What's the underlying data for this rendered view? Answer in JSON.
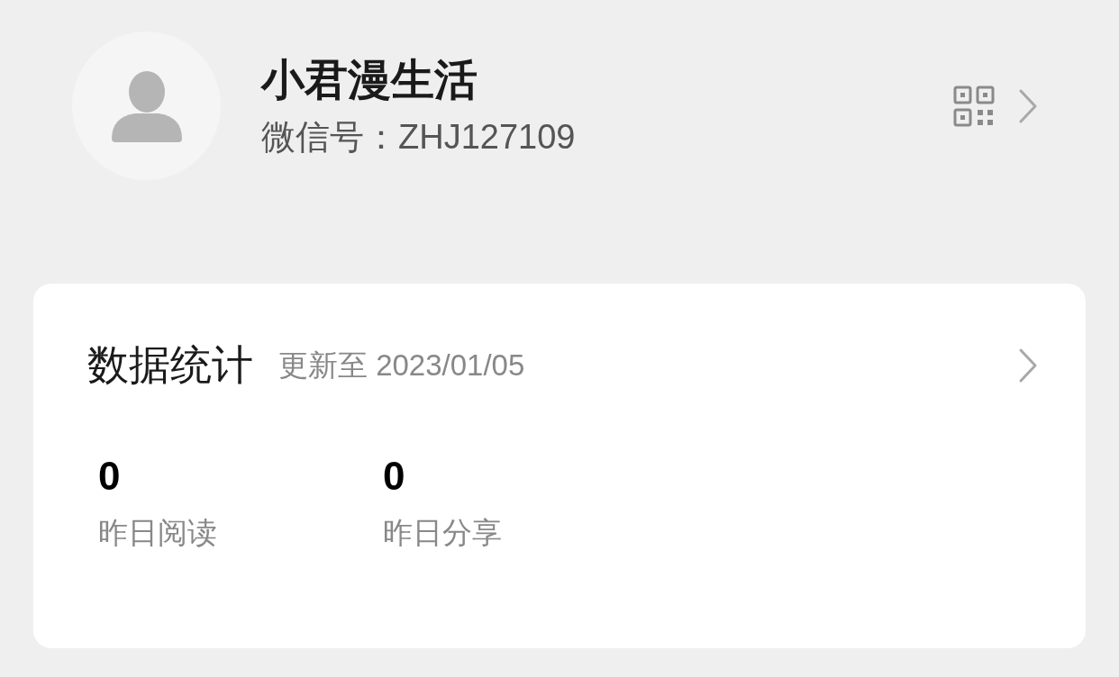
{
  "profile": {
    "name": "小君漫生活",
    "wechat_id": "微信号：ZHJ127109"
  },
  "stats_card": {
    "title": "数据统计",
    "updated": "更新至 2023/01/05",
    "stats": [
      {
        "value": "0",
        "label": "昨日阅读"
      },
      {
        "value": "0",
        "label": "昨日分享"
      }
    ]
  }
}
